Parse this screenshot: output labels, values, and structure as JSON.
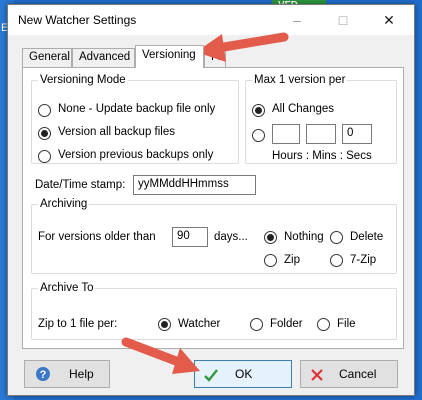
{
  "background": {
    "left_text": "Ev",
    "badge": "VFD"
  },
  "window": {
    "title": "New Watcher Settings",
    "minimize": "–",
    "maximize": "□",
    "close": "✕"
  },
  "tabs": [
    "General",
    "Advanced",
    "Versioning",
    "Fi"
  ],
  "versioning_mode": {
    "legend": "Versioning Mode",
    "options": [
      "None - Update backup file only",
      "Version all backup files",
      "Version previous backups only"
    ],
    "selected": 1
  },
  "max_version": {
    "legend": "Max 1 version per",
    "all_changes": "All Changes",
    "hours": "",
    "mins": "",
    "secs": "0",
    "hint": "Hours : Mins : Secs"
  },
  "datetime": {
    "label": "Date/Time stamp:",
    "value": "yyMMddHHmmss"
  },
  "archiving": {
    "legend": "Archiving",
    "older_label": "For versions older than",
    "days_value": "90",
    "days_label": "days...",
    "options": [
      "Nothing",
      "Delete",
      "Zip",
      "7-Zip"
    ],
    "selected": 0
  },
  "archive_to": {
    "legend": "Archive To",
    "label": "Zip to 1 file per:",
    "options": [
      "Watcher",
      "Folder",
      "File"
    ],
    "selected": 0
  },
  "buttons": {
    "help": "Help",
    "ok": "OK",
    "cancel": "Cancel"
  },
  "colors": {
    "accent": "#e35b4b",
    "ok_check": "#2e9a3e",
    "cancel_x": "#d33"
  }
}
